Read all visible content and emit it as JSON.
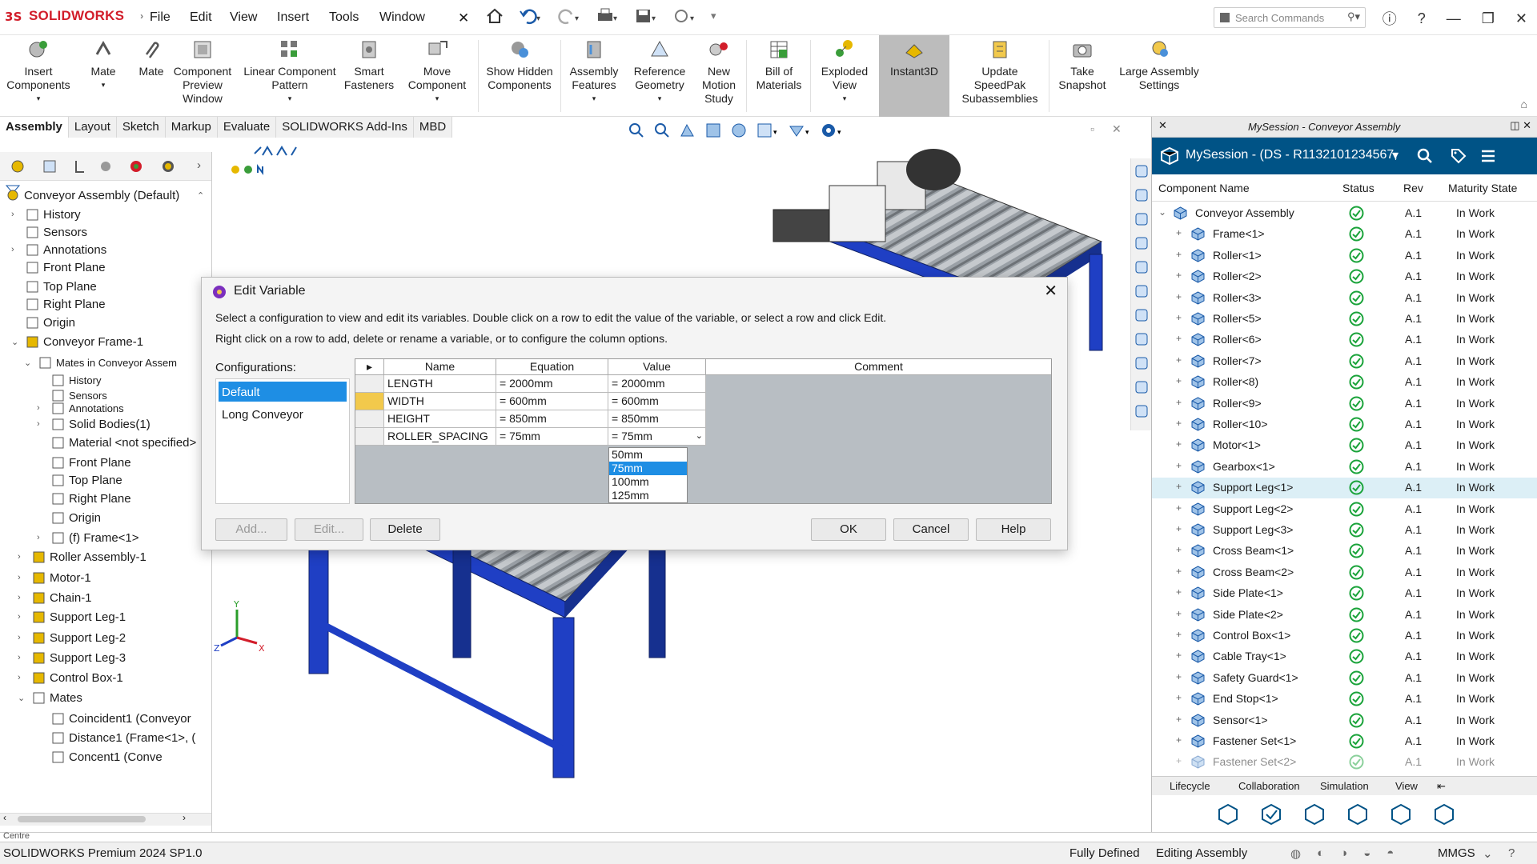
{
  "app": {
    "brand": "SOLIDWORKS"
  },
  "menu": [
    "File",
    "Edit",
    "View",
    "Insert",
    "Tools",
    "Window"
  ],
  "search": {
    "placeholder": "Search Commands"
  },
  "ribbon": {
    "insert_components": "Insert Components",
    "mate1": "Mate",
    "mate2": "Mate",
    "component_preview": "Component Preview Window",
    "linear_pattern": "Linear Component Pattern",
    "smart_fasteners": "Smart Fasteners",
    "move_component": "Move Component",
    "show_hidden": "Show Hidden Components",
    "assembly_features": "Assembly Features",
    "reference_geometry": "Reference Geometry",
    "new_motion": "New Motion Study",
    "bom": "Bill of Materials",
    "exploded_view": "Exploded View",
    "instant3d": "Instant3D",
    "speedpak": "Update SpeedPak Subassemblies",
    "snapshot": "Take Snapshot",
    "large_assembly": "Large Assembly Settings"
  },
  "cm_tabs": [
    "Assembly",
    "Layout",
    "Sketch",
    "Markup",
    "Evaluate",
    "SOLIDWORKS Add-Ins",
    "MBD"
  ],
  "tree": {
    "root": "Conveyor Assembly  (Default)",
    "items": [
      "History",
      "Sensors",
      "Annotations",
      "Front Plane",
      "Top Plane",
      "Right Plane",
      "Origin",
      "Conveyor Frame-1",
      "Mates in Conveyor Assem",
      "History",
      "Sensors",
      "Annotations",
      "Solid Bodies(1)",
      "Material <not specified>",
      "Front Plane",
      "Top Plane",
      "Right Plane",
      "Origin",
      "(f) Frame<1>",
      "Roller Assembly-1",
      "Motor-1",
      "Chain-1",
      "Support Leg-1",
      "Support Leg-2",
      "Support Leg-3",
      "Control Box-1",
      "Mates",
      "Coincident1 (Conveyor",
      "Distance1 (Frame<1>, (",
      "Concent1 (Conve"
    ],
    "bottom_label": "Centre"
  },
  "dialog": {
    "title": "Edit Variable",
    "desc1": "Select a configuration to view and edit its variables. Double click on a row to edit the value of the variable, or select a row and click Edit.",
    "desc2": "Right click on a row to add, delete or rename a variable, or to configure the column options.",
    "configs_label": "Configurations:",
    "configs": [
      "Default",
      "Long Conveyor"
    ],
    "columns": [
      "Name",
      "Equation",
      "Value",
      "Comment"
    ],
    "rows": [
      {
        "name": "LENGTH",
        "equation": "= 2000mm",
        "value": "= 2000mm"
      },
      {
        "name": "WIDTH",
        "equation": "= 600mm",
        "value": "= 600mm"
      },
      {
        "name": "HEIGHT",
        "equation": "= 850mm",
        "value": "= 850mm"
      },
      {
        "name": "ROLLER_SPACING",
        "equation": "= 75mm",
        "value": "= 75mm"
      }
    ],
    "dropdown": [
      "50mm",
      "75mm",
      "100mm",
      "125mm"
    ],
    "buttons": {
      "add": "Add...",
      "edit": "Edit...",
      "delete": "Delete",
      "ok": "OK",
      "cancel": "Cancel",
      "help": "Help"
    }
  },
  "session": {
    "title": "MySession - (DS - R1132101234567,",
    "topbar": "MySession - Conveyor Assembly",
    "columns": [
      "Component Name",
      "Status",
      "Rev",
      "Maturity State"
    ],
    "rows": [
      {
        "name": "Conveyor Assembly",
        "rev": "A.1",
        "state": "In Work"
      },
      {
        "name": "Frame<1>",
        "rev": "A.1",
        "state": "In Work"
      },
      {
        "name": "Roller<1>",
        "rev": "A.1",
        "state": "In Work"
      },
      {
        "name": "Roller<2>",
        "rev": "A.1",
        "state": "In Work"
      },
      {
        "name": "Roller<3>",
        "rev": "A.1",
        "state": "In Work"
      },
      {
        "name": "Roller<5>",
        "rev": "A.1",
        "state": "In Work"
      },
      {
        "name": "Roller<6>",
        "rev": "A.1",
        "state": "In Work"
      },
      {
        "name": "Roller<7>",
        "rev": "A.1",
        "state": "In Work"
      },
      {
        "name": "Roller<8)",
        "rev": "A.1",
        "state": "In Work"
      },
      {
        "name": "Roller<9>",
        "rev": "A.1",
        "state": "In Work"
      },
      {
        "name": "Roller<10>",
        "rev": "A.1",
        "state": "In Work"
      },
      {
        "name": "Motor<1>",
        "rev": "A.1",
        "state": "In Work"
      },
      {
        "name": "Gearbox<1>",
        "rev": "A.1",
        "state": "In Work"
      },
      {
        "name": "Support Leg<1>",
        "rev": "A.1",
        "state": "In Work"
      },
      {
        "name": "Support Leg<2>",
        "rev": "A.1",
        "state": "In Work"
      },
      {
        "name": "Support Leg<3>",
        "rev": "A.1",
        "state": "In Work"
      },
      {
        "name": "Cross Beam<1>",
        "rev": "A.1",
        "state": "In Work"
      },
      {
        "name": "Cross Beam<2>",
        "rev": "A.1",
        "state": "In Work"
      },
      {
        "name": "Side Plate<1>",
        "rev": "A.1",
        "state": "In Work"
      },
      {
        "name": "Side Plate<2>",
        "rev": "A.1",
        "state": "In Work"
      },
      {
        "name": "Control Box<1>",
        "rev": "A.1",
        "state": "In Work"
      },
      {
        "name": "Cable Tray<1>",
        "rev": "A.1",
        "state": "In Work"
      },
      {
        "name": "Safety Guard<1>",
        "rev": "A.1",
        "state": "In Work"
      },
      {
        "name": "End Stop<1>",
        "rev": "A.1",
        "state": "In Work"
      },
      {
        "name": "Sensor<1>",
        "rev": "A.1",
        "state": "In Work"
      },
      {
        "name": "Fastener Set<1>",
        "rev": "A.1",
        "state": "In Work"
      },
      {
        "name": "Fastener Set<2>",
        "rev": "A.1",
        "state": "In Work"
      }
    ],
    "bottom_tabs": [
      "Lifecycle",
      "Collaboration",
      "Simulation",
      "View"
    ]
  },
  "status": {
    "version": "SOLIDWORKS Premium 2024 SP1.0",
    "defined": "Fully Defined",
    "editing": "Editing Assembly",
    "units": "MMGS"
  },
  "colors": {
    "accent": "#1e8ee4",
    "frame_blue": "#1f3fc4",
    "session_header": "#005386",
    "check_green": "#1aa33a"
  }
}
